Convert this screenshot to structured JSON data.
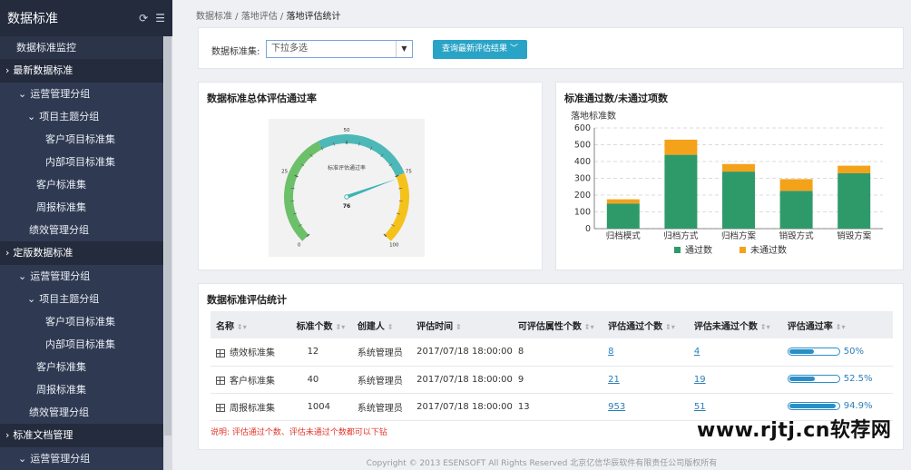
{
  "sidebar": {
    "title": "数据标准",
    "items": [
      {
        "label": "数据标准监控",
        "indent": 18,
        "kind": "item"
      },
      {
        "label": "最新数据标准",
        "indent": 6,
        "kind": "section",
        "caret": "›"
      },
      {
        "label": "运营管理分组",
        "indent": 20,
        "kind": "sub",
        "caret": "⌄"
      },
      {
        "label": "项目主题分组",
        "indent": 30,
        "kind": "sub",
        "caret": "⌄"
      },
      {
        "label": "客户项目标准集",
        "indent": 50,
        "kind": "sub"
      },
      {
        "label": "内部项目标准集",
        "indent": 50,
        "kind": "sub"
      },
      {
        "label": "客户标准集",
        "indent": 40,
        "kind": "sub"
      },
      {
        "label": "周报标准集",
        "indent": 40,
        "kind": "sub"
      },
      {
        "label": "绩效管理分组",
        "indent": 32,
        "kind": "sub"
      },
      {
        "label": "定版数据标准",
        "indent": 6,
        "kind": "section",
        "caret": "›"
      },
      {
        "label": "运营管理分组",
        "indent": 20,
        "kind": "sub",
        "caret": "⌄"
      },
      {
        "label": "项目主题分组",
        "indent": 30,
        "kind": "sub",
        "caret": "⌄"
      },
      {
        "label": "客户项目标准集",
        "indent": 50,
        "kind": "sub"
      },
      {
        "label": "内部项目标准集",
        "indent": 50,
        "kind": "sub"
      },
      {
        "label": "客户标准集",
        "indent": 40,
        "kind": "sub"
      },
      {
        "label": "周报标准集",
        "indent": 40,
        "kind": "sub"
      },
      {
        "label": "绩效管理分组",
        "indent": 32,
        "kind": "sub"
      },
      {
        "label": "标准文档管理",
        "indent": 6,
        "kind": "section",
        "caret": "›"
      },
      {
        "label": "运营管理分组",
        "indent": 20,
        "kind": "sub",
        "caret": "⌄"
      }
    ]
  },
  "breadcrumb": {
    "a": "数据标准",
    "sep": " / ",
    "b": "落地评估",
    "c": "落地评估统计"
  },
  "filter": {
    "label": "数据标准集:",
    "placeholder": "下拉多选",
    "button": "查询最新评估结果"
  },
  "gauge": {
    "title": "数据标准总体评估通过率",
    "inner_title": "标准评估通过率",
    "value": 76,
    "value_label": "76",
    "ticks": [
      "0",
      "25",
      "50",
      "75",
      "100"
    ],
    "colors": {
      "low": "#6cc06a",
      "mid": "#4db8b8",
      "high": "#f4c21b",
      "needle": "#3bb3b3"
    }
  },
  "chart_data": {
    "type": "bar",
    "stacked": true,
    "title": "标准通过数/未通过项数",
    "ylabel": "落地标准数",
    "categories": [
      "归档模式",
      "归档方式",
      "归档方案",
      "销毁方式",
      "销毁方案"
    ],
    "series": [
      {
        "name": "通过数",
        "color": "#2e9a6a",
        "values": [
          150,
          440,
          340,
          225,
          330
        ]
      },
      {
        "name": "未通过数",
        "color": "#f5a21b",
        "values": [
          25,
          90,
          45,
          70,
          45
        ]
      }
    ],
    "ylim": [
      0,
      600
    ],
    "yticks": [
      "0",
      "100",
      "200",
      "300",
      "400",
      "500",
      "600"
    ],
    "legend": "bottom"
  },
  "table": {
    "title": "数据标准评估统计",
    "headers": [
      "名称",
      "标准个数",
      "创建人",
      "评估时间",
      "可评估属性个数",
      "评估通过个数",
      "评估未通过个数",
      "评估通过率"
    ],
    "rows": [
      {
        "name": "绩效标准集",
        "count": "12",
        "creator": "系统管理员",
        "time": "2017/07/18  18:00:00",
        "attrs": "8",
        "pass": "8",
        "fail": "4",
        "rate": 0.5,
        "rate_label": "50%"
      },
      {
        "name": "客户标准集",
        "count": "40",
        "creator": "系统管理员",
        "time": "2017/07/18  18:00:00",
        "attrs": "9",
        "pass": "21",
        "fail": "19",
        "rate": 0.525,
        "rate_label": "52.5%"
      },
      {
        "name": "周报标准集",
        "count": "1004",
        "creator": "系统管理员",
        "time": "2017/07/18  18:00:00",
        "attrs": "13",
        "pass": "953",
        "fail": "51",
        "rate": 0.949,
        "rate_label": "94.9%"
      }
    ],
    "note": "说明: 评估通过个数、评估未通过个数都可以下钻"
  },
  "watermark": "www.rjtj.cn软荐网",
  "footer": "Copyright © 2013 ESENSOFT All Rights Reserved 北京亿信华辰软件有限责任公司版权所有"
}
